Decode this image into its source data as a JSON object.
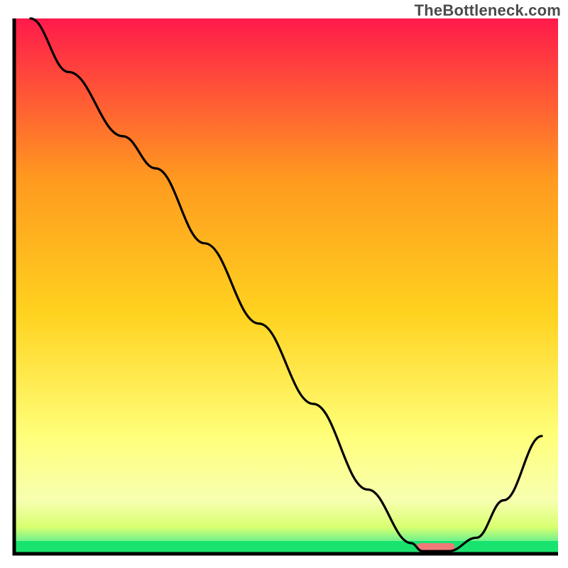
{
  "watermark": "TheBottleneck.com",
  "chart_data": {
    "type": "line",
    "title": "",
    "xlabel": "",
    "ylabel": "",
    "xlim": [
      0,
      100
    ],
    "ylim": [
      0,
      100
    ],
    "grid": false,
    "axes_visible": false,
    "series": [
      {
        "name": "curve",
        "x": [
          3,
          10,
          20,
          26,
          35,
          45,
          55,
          65,
          73,
          75,
          80,
          85,
          90,
          97
        ],
        "values": [
          100,
          90,
          78,
          72,
          58,
          43,
          28,
          12,
          2,
          0.5,
          0.5,
          3,
          10,
          22
        ]
      }
    ],
    "optimal_marker": {
      "x_start": 74,
      "x_end": 81,
      "y": 1.2
    },
    "background_gradient": {
      "top": "#ff1a4b",
      "mid_upper": "#ff9a1f",
      "mid": "#ffd21f",
      "mid_lower": "#ffff7a",
      "low": "#f7ffb0",
      "band": "#d9ff70",
      "bottom": "#11e36a"
    }
  }
}
